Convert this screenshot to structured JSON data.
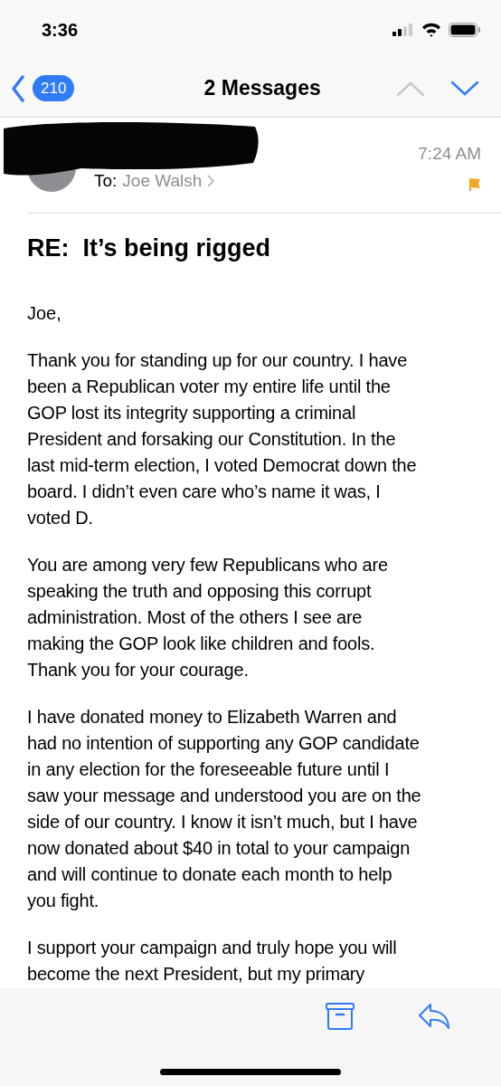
{
  "status_bar": {
    "time": "3:36"
  },
  "nav": {
    "unread_count": "210",
    "title": "2 Messages"
  },
  "message": {
    "to_label": "To:",
    "recipient": "Joe Walsh",
    "time": "7:24 AM",
    "flagged": true,
    "subject": "RE:  It’s being rigged",
    "greeting": "Joe,",
    "paragraphs": [
      [
        "Thank you for standing up for our country. I have",
        "been a Republican voter my entire life until the",
        "GOP lost its integrity supporting a criminal",
        "President and forsaking our Constitution. In the",
        "last mid-term election, I voted Democrat down the",
        "board. I didn’t even care who’s name it was, I",
        "voted D."
      ],
      [
        "You are among very few Republicans who are",
        "speaking the truth and opposing this corrupt",
        "administration. Most of the others I see are",
        "making the GOP look like children and fools.",
        "Thank you for your courage."
      ],
      [
        "I have donated money to Elizabeth Warren and",
        "had no intention of supporting any GOP candidate",
        "in any election for the foreseeable future until I",
        "saw your message and understood you are on the",
        "side of our country. I know it isn’t much, but I have",
        "now donated about $40 in total to your campaign",
        "and will continue to donate each month to help",
        "you fight."
      ],
      [
        "I support your campaign and truly hope you will",
        "become the next President, but my primary"
      ]
    ]
  }
}
